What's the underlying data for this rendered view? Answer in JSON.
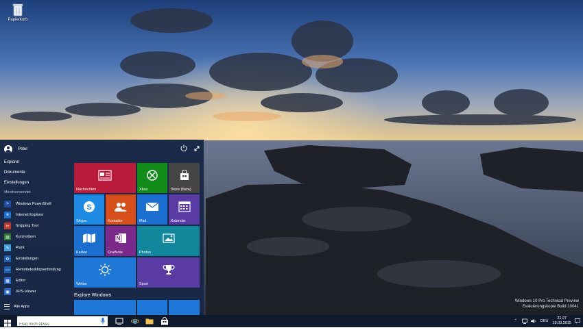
{
  "desktop": {
    "icon_label": "Papierkorb",
    "watermark": [
      "Windows 10 Pro Technical Preview",
      "Evaluierungskopie Build 10041"
    ]
  },
  "start_menu": {
    "user": "Peter",
    "places": [
      "Explorer",
      "Dokumente",
      "Einstellungen"
    ],
    "most_used_label": "Meistverwendet",
    "apps": [
      {
        "label": "Windows PowerShell",
        "color": "#1e4ea1",
        "glyph": ">"
      },
      {
        "label": "Internet Explorer",
        "color": "#1f73d0",
        "glyph": "e"
      },
      {
        "label": "Snipping Tool",
        "color": "#c0392b",
        "glyph": "✂"
      },
      {
        "label": "Kurznotizen",
        "color": "#2e7d32",
        "glyph": "▤"
      },
      {
        "label": "Paint",
        "color": "#3fa3e0",
        "glyph": "✎"
      },
      {
        "label": "Einstellungen",
        "color": "#1b5fb0",
        "glyph": "⚙"
      },
      {
        "label": "Remotedesktopverbindung",
        "color": "#1b5fb0",
        "glyph": "▭"
      },
      {
        "label": "Editor",
        "color": "#2566c4",
        "glyph": "▦"
      },
      {
        "label": "XPS-Viewer",
        "color": "#2566c4",
        "glyph": "▣"
      }
    ],
    "all_apps": "Alle Apps",
    "explore_label": "Explore Windows",
    "tiles": [
      {
        "label": "Nachrichten",
        "color": "#b81c3a"
      },
      {
        "label": "Xbox",
        "color": "#118c18"
      },
      {
        "label": "Store (Beta)",
        "color": "#454545"
      },
      {
        "label": "Skype",
        "color": "#1d8be4"
      },
      {
        "label": "Kontakte",
        "color": "#d64f1a"
      },
      {
        "label": "Mail",
        "color": "#1a6fd0"
      },
      {
        "label": "Kalender",
        "color": "#5a3aa3"
      },
      {
        "label": "Karten",
        "color": "#1a6fd0"
      },
      {
        "label": "OneNote",
        "color": "#7b2a8c"
      },
      {
        "label": "Photos",
        "color": "#10879a"
      },
      {
        "label": "Wetter",
        "color": "#1e78d7"
      },
      {
        "label": "Sport",
        "color": "#5a3aa3"
      }
    ]
  },
  "taskbar": {
    "search_placeholder": "Frag mich etwas",
    "language": "DEU",
    "time": "21:27",
    "date": "19.03.2015"
  }
}
